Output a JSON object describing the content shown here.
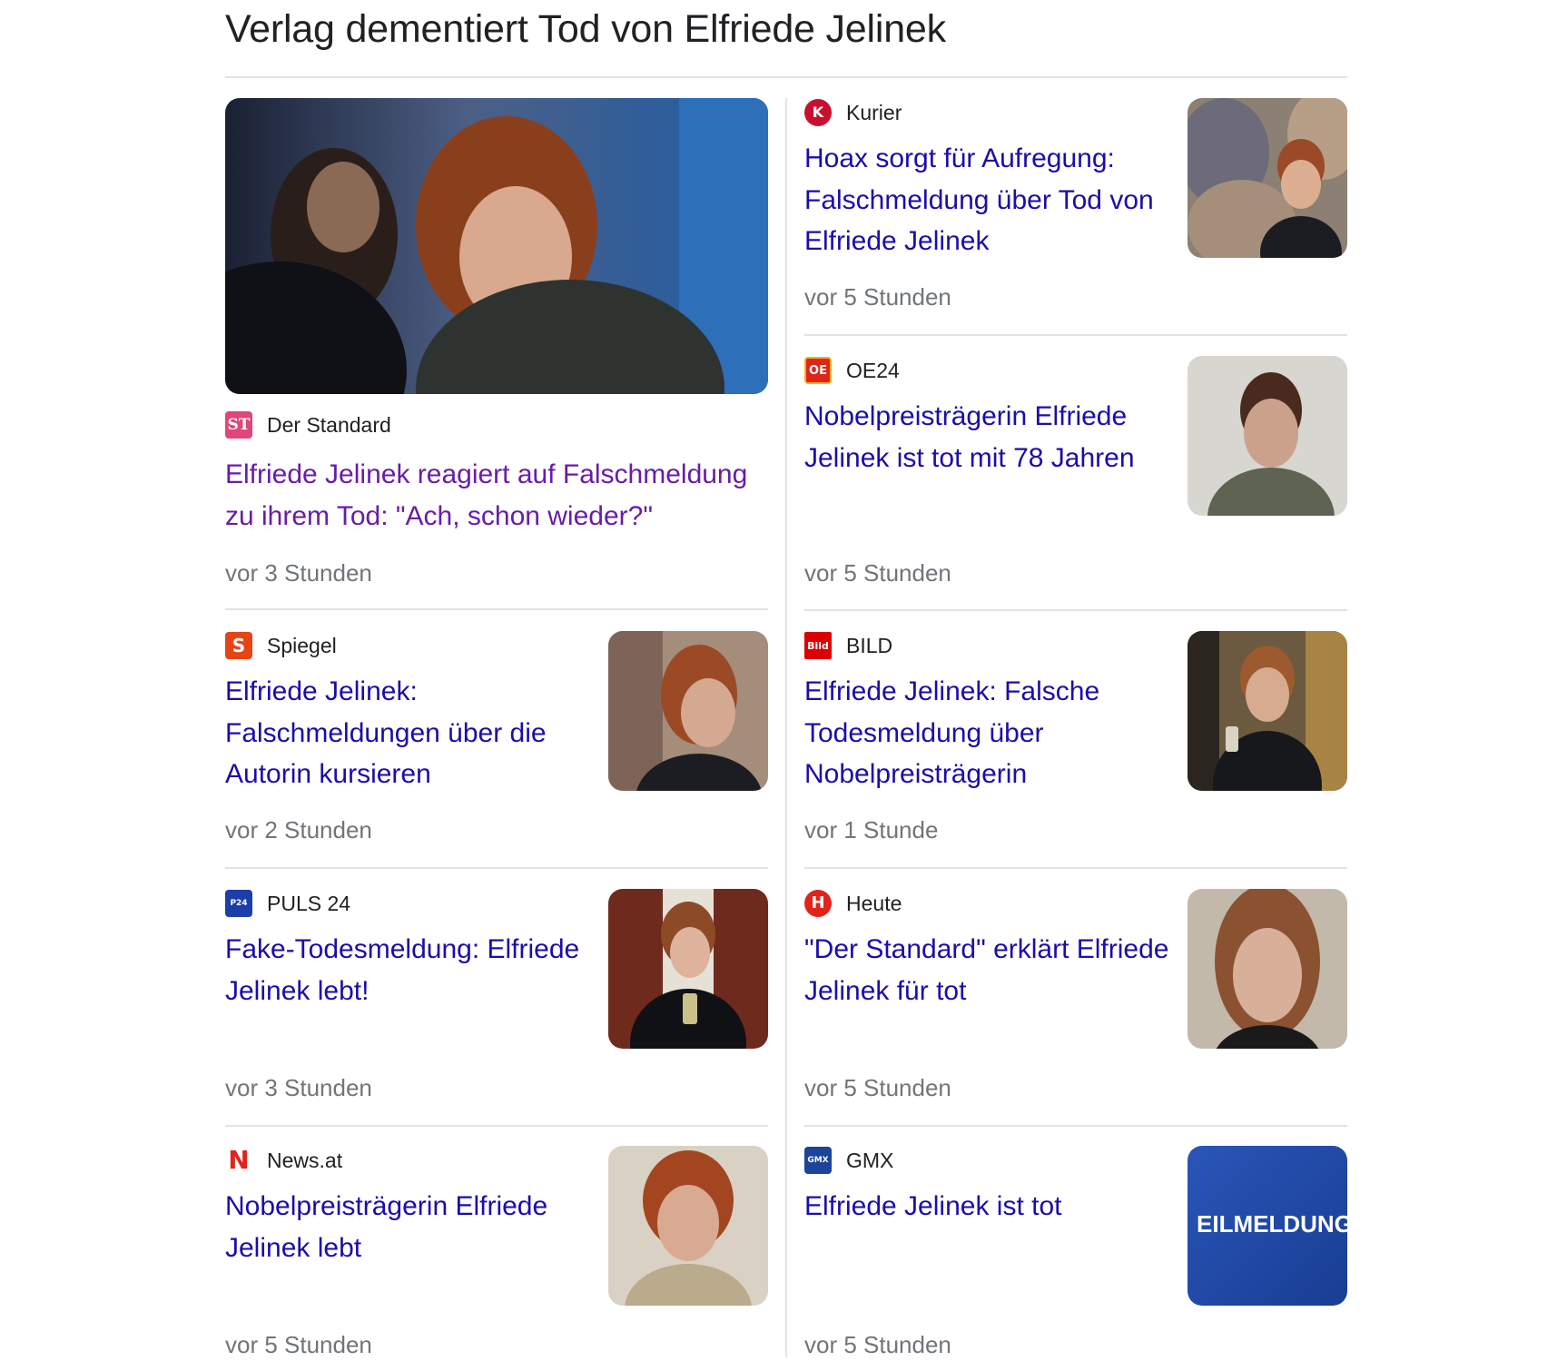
{
  "headline": "Verlag dementiert Tod von Elfriede Jelinek",
  "colors": {
    "link": "#1a0dab",
    "visited_link": "#681da8",
    "meta": "#70757a",
    "divider": "#e3e3e3"
  },
  "articles": [
    {
      "source": "Der Standard",
      "logo_text": "ST",
      "logo_color": "#e0457b",
      "icon": "der-standard-logo",
      "title": "Elfriede Jelinek reagiert auf Falschmeldung zu ihrem Tod: \"Ach, schon wieder?\"",
      "time": "vor 3 Stunden",
      "visited": true,
      "image": "photo-jelinek-smiling"
    },
    {
      "source": "Kurier",
      "logo_text": "K",
      "logo_color": "#c8102e",
      "icon": "kurier-logo",
      "title": "Hoax sorgt für Aufregung: Falschmeldung über Tod von Elfriede Jelinek",
      "time": "vor 5 Stunden",
      "image": "photo-jelinek-painting"
    },
    {
      "source": "OE24",
      "logo_text": "OE",
      "logo_color": "#e2231a",
      "icon": "oe24-logo",
      "title": "Nobelpreisträgerin Elfriede Jelinek ist tot mit 78 Jahren",
      "time": "vor 5 Stunden",
      "image": "photo-jelinek-portrait"
    },
    {
      "source": "Spiegel",
      "logo_text": "S",
      "logo_color": "#e64415",
      "icon": "spiegel-logo",
      "title": "Elfriede Jelinek: Falschmeldungen über die Autorin kursieren",
      "time": "vor 2 Stunden",
      "image": "photo-jelinek-looking-up"
    },
    {
      "source": "BILD",
      "logo_text": "Bild",
      "logo_color": "#dd0000",
      "icon": "bild-logo",
      "title": "Elfriede Jelinek: Falsche Todesmeldung über Nobelpreisträgerin",
      "time": "vor 1 Stunde",
      "image": "photo-jelinek-toast"
    },
    {
      "source": "PULS 24",
      "logo_text": "P24",
      "logo_color": "#1d3ea8",
      "icon": "puls24-logo",
      "title": "Fake-Todesmeldung: Elfriede Jelinek lebt!",
      "time": "vor 3 Stunden",
      "image": "photo-jelinek-laughing"
    },
    {
      "source": "Heute",
      "logo_text": "H",
      "logo_color": "#e2231a",
      "icon": "heute-logo",
      "title": "\"Der Standard\" erklärt Elfriede Jelinek für tot",
      "time": "vor 5 Stunden",
      "image": "photo-jelinek-closeup"
    },
    {
      "source": "News.at",
      "logo_text": "N",
      "logo_color": "#e2231a",
      "icon": "news-at-logo",
      "title": "Nobelpreisträgerin Elfriede Jelinek lebt",
      "time": "vor 5 Stunden",
      "image": "photo-jelinek-red-hair"
    },
    {
      "source": "GMX",
      "logo_text": "GMX",
      "logo_color": "#1c449b",
      "icon": "gmx-logo",
      "title": "Elfriede Jelinek ist tot",
      "time": "vor 5 Stunden",
      "image": "eilmeldung-graphic",
      "image_text": "EILMELDUNG"
    }
  ]
}
